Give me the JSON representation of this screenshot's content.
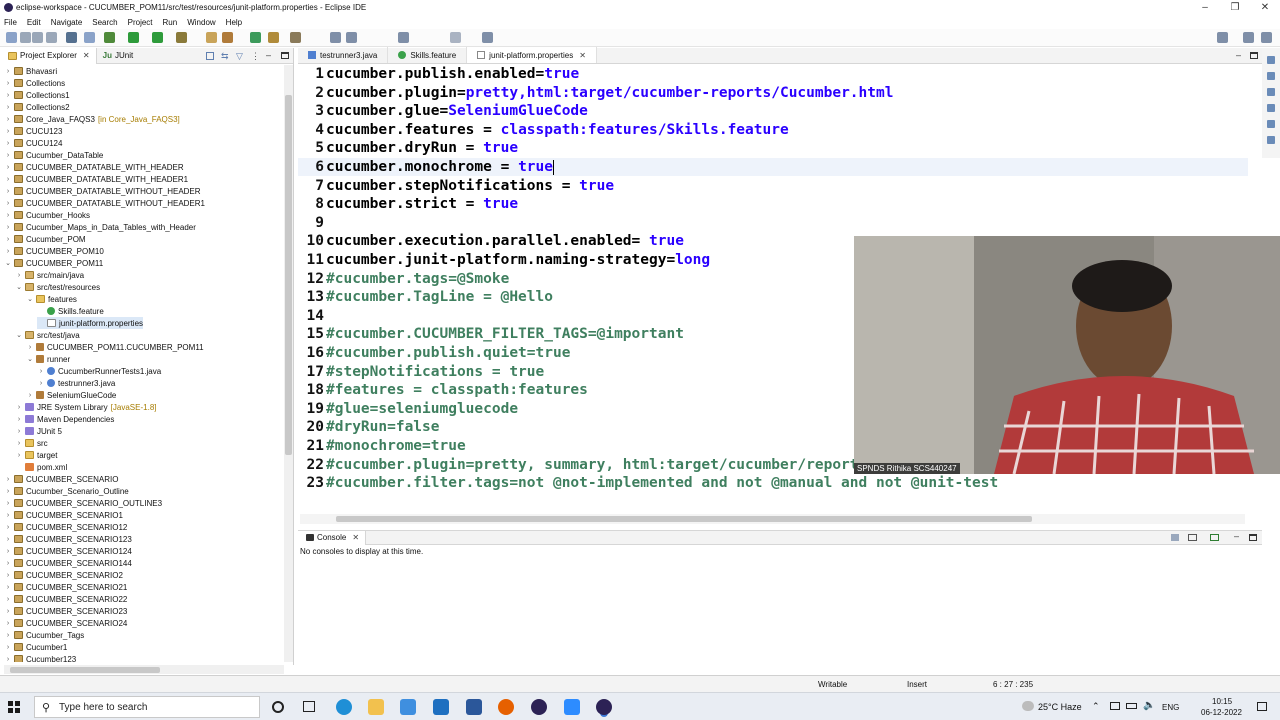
{
  "window": {
    "title": "eclipse-workspace - CUCUMBER_POM11/src/test/resources/junit-platform.properties - Eclipse IDE"
  },
  "menu": [
    "File",
    "Edit",
    "Navigate",
    "Search",
    "Project",
    "Run",
    "Window",
    "Help"
  ],
  "left_panel": {
    "tabs": [
      "Project Explorer",
      "JUnit"
    ],
    "tree": [
      {
        "label": "Bhavasri",
        "depth": 0,
        "icon": "project-icon",
        "tw": "›"
      },
      {
        "label": "Collections",
        "depth": 0,
        "icon": "project-icon",
        "tw": "›"
      },
      {
        "label": "Collections1",
        "depth": 0,
        "icon": "project-icon",
        "tw": "›"
      },
      {
        "label": "Collections2",
        "depth": 0,
        "icon": "project-icon",
        "tw": "›"
      },
      {
        "label": "Core_Java_FAQS3",
        "annotation": "[in Core_Java_FAQS3]",
        "depth": 0,
        "icon": "project-icon",
        "tw": "›"
      },
      {
        "label": "CUCU123",
        "depth": 0,
        "icon": "project-icon",
        "tw": "›"
      },
      {
        "label": "CUCU124",
        "depth": 0,
        "icon": "project-icon",
        "tw": "›"
      },
      {
        "label": "Cucumber_DataTable",
        "depth": 0,
        "icon": "project-icon",
        "tw": "›"
      },
      {
        "label": "CUCUMBER_DATATABLE_WITH_HEADER",
        "depth": 0,
        "icon": "project-icon",
        "tw": "›"
      },
      {
        "label": "CUCUMBER_DATATABLE_WITH_HEADER1",
        "depth": 0,
        "icon": "project-icon",
        "tw": "›"
      },
      {
        "label": "CUCUMBER_DATATABLE_WITHOUT_HEADER",
        "depth": 0,
        "icon": "project-icon",
        "tw": "›"
      },
      {
        "label": "CUCUMBER_DATATABLE_WITHOUT_HEADER1",
        "depth": 0,
        "icon": "project-icon",
        "tw": "›"
      },
      {
        "label": "Cucumber_Hooks",
        "depth": 0,
        "icon": "project-icon",
        "tw": "›"
      },
      {
        "label": "Cucumber_Maps_in_Data_Tables_with_Header",
        "depth": 0,
        "icon": "project-icon",
        "tw": "›"
      },
      {
        "label": "Cucumber_POM",
        "depth": 0,
        "icon": "project-icon",
        "tw": "›"
      },
      {
        "label": "CUCUMBER_POM10",
        "depth": 0,
        "icon": "project-icon",
        "tw": "›"
      },
      {
        "label": "CUCUMBER_POM11",
        "depth": 0,
        "icon": "project-icon",
        "tw": "⌄"
      },
      {
        "label": "src/main/java",
        "depth": 1,
        "icon": "source-folder-icon",
        "tw": "›"
      },
      {
        "label": "src/test/resources",
        "depth": 1,
        "icon": "source-folder-icon",
        "tw": "⌄"
      },
      {
        "label": "features",
        "depth": 2,
        "icon": "folder-icon",
        "tw": "⌄"
      },
      {
        "label": "Skills.feature",
        "depth": 3,
        "icon": "feature-file-icon",
        "tw": ""
      },
      {
        "label": "junit-platform.properties",
        "depth": 3,
        "icon": "properties-file-icon",
        "tw": "",
        "selected": true
      },
      {
        "label": "src/test/java",
        "depth": 1,
        "icon": "source-folder-icon",
        "tw": "⌄"
      },
      {
        "label": "CUCUMBER_POM11.CUCUMBER_POM11",
        "depth": 2,
        "icon": "package-icon",
        "tw": "›"
      },
      {
        "label": "runner",
        "depth": 2,
        "icon": "package-icon",
        "tw": "⌄"
      },
      {
        "label": "CucumberRunnerTests1.java",
        "depth": 3,
        "icon": "java-file-icon",
        "tw": "›"
      },
      {
        "label": "testrunner3.java",
        "depth": 3,
        "icon": "java-file-icon",
        "tw": "›"
      },
      {
        "label": "SeleniumGlueCode",
        "depth": 2,
        "icon": "package-icon",
        "tw": "›"
      },
      {
        "label": "JRE System Library",
        "annotation": "[JavaSE-1.8]",
        "depth": 1,
        "icon": "library-icon",
        "tw": "›"
      },
      {
        "label": "Maven Dependencies",
        "depth": 1,
        "icon": "library-icon",
        "tw": "›"
      },
      {
        "label": "JUnit 5",
        "depth": 1,
        "icon": "library-icon",
        "tw": "›"
      },
      {
        "label": "src",
        "depth": 1,
        "icon": "folder-icon",
        "tw": "›"
      },
      {
        "label": "target",
        "depth": 1,
        "icon": "folder-icon",
        "tw": "›"
      },
      {
        "label": "pom.xml",
        "depth": 1,
        "icon": "xml-file-icon",
        "tw": ""
      },
      {
        "label": "CUCUMBER_SCENARIO",
        "depth": 0,
        "icon": "project-icon",
        "tw": "›"
      },
      {
        "label": "Cucumber_Scenario_Outline",
        "depth": 0,
        "icon": "project-icon",
        "tw": "›"
      },
      {
        "label": "CUCUMBER_SCENARIO_OUTLINE3",
        "depth": 0,
        "icon": "project-icon",
        "tw": "›"
      },
      {
        "label": "CUCUMBER_SCENARIO1",
        "depth": 0,
        "icon": "project-icon",
        "tw": "›"
      },
      {
        "label": "CUCUMBER_SCENARIO12",
        "depth": 0,
        "icon": "project-icon",
        "tw": "›"
      },
      {
        "label": "CUCUMBER_SCENARIO123",
        "depth": 0,
        "icon": "project-icon",
        "tw": "›"
      },
      {
        "label": "CUCUMBER_SCENARIO124",
        "depth": 0,
        "icon": "project-icon",
        "tw": "›"
      },
      {
        "label": "CUCUMBER_SCENARIO144",
        "depth": 0,
        "icon": "project-icon",
        "tw": "›"
      },
      {
        "label": "CUCUMBER_SCENARIO2",
        "depth": 0,
        "icon": "project-icon",
        "tw": "›"
      },
      {
        "label": "CUCUMBER_SCENARIO21",
        "depth": 0,
        "icon": "project-icon",
        "tw": "›"
      },
      {
        "label": "CUCUMBER_SCENARIO22",
        "depth": 0,
        "icon": "project-icon",
        "tw": "›"
      },
      {
        "label": "CUCUMBER_SCENARIO23",
        "depth": 0,
        "icon": "project-icon",
        "tw": "›"
      },
      {
        "label": "CUCUMBER_SCENARIO24",
        "depth": 0,
        "icon": "project-icon",
        "tw": "›"
      },
      {
        "label": "Cucumber_Tags",
        "depth": 0,
        "icon": "project-icon",
        "tw": "›"
      },
      {
        "label": "Cucumber1",
        "depth": 0,
        "icon": "project-icon",
        "tw": "›"
      },
      {
        "label": "Cucumber123",
        "depth": 0,
        "icon": "project-icon",
        "tw": "›"
      }
    ]
  },
  "editor": {
    "tabs": [
      {
        "label": "testrunner3.java",
        "icon": "java-file-icon",
        "active": false
      },
      {
        "label": "Skills.feature",
        "icon": "feature-file-icon",
        "active": false
      },
      {
        "label": "junit-platform.properties",
        "icon": "properties-file-icon",
        "active": true
      }
    ],
    "lines": [
      {
        "n": "1",
        "key": "cucumber.publish.enabled=",
        "val": "true"
      },
      {
        "n": "2",
        "key": "cucumber.plugin=",
        "val": "pretty,html:target/cucumber-reports/Cucumber.html"
      },
      {
        "n": "3",
        "key": "cucumber.glue=",
        "val": "SeleniumGlueCode"
      },
      {
        "n": "4",
        "key": "cucumber.features = ",
        "val": "classpath:features/Skills.feature"
      },
      {
        "n": "5",
        "key": "cucumber.dryRun = ",
        "val": "true"
      },
      {
        "n": "6",
        "key": "cucumber.monochrome = ",
        "val": "true",
        "current": true
      },
      {
        "n": "7",
        "key": "cucumber.stepNotifications = ",
        "val": "true"
      },
      {
        "n": "8",
        "key": "cucumber.strict = ",
        "val": "true"
      },
      {
        "n": "9",
        "key": "",
        "val": ""
      },
      {
        "n": "10",
        "key": "cucumber.execution.parallel.enabled= ",
        "val": "true"
      },
      {
        "n": "11",
        "key": "cucumber.junit-platform.naming-strategy=",
        "val": "long"
      },
      {
        "n": "12",
        "comment": "#cucumber.tags=@Smoke"
      },
      {
        "n": "13",
        "comment": "#cucumber.TagLine = @Hello"
      },
      {
        "n": "14",
        "key": "",
        "val": ""
      },
      {
        "n": "15",
        "comment": "#cucumber.CUCUMBER_FILTER_TAGS=@important"
      },
      {
        "n": "16",
        "comment": "#cucumber.publish.quiet=true"
      },
      {
        "n": "17",
        "comment": "#stepNotifications = true"
      },
      {
        "n": "18",
        "comment": "#features = classpath:features"
      },
      {
        "n": "19",
        "comment": "#glue=seleniumgluecode"
      },
      {
        "n": "20",
        "comment": "#dryRun=false"
      },
      {
        "n": "21",
        "comment": "#monochrome=true"
      },
      {
        "n": "22",
        "comment": "#cucumber.plugin=pretty, summary, html:target/cucumber/report"
      },
      {
        "n": "23",
        "comment": "#cucumber.filter.tags=not @not-implemented and not @manual and not @unit-test"
      }
    ]
  },
  "console": {
    "tab": "Console",
    "message": "No consoles to display at this time."
  },
  "status": {
    "writable": "Writable",
    "insert": "Insert",
    "position": "6 : 27 : 235"
  },
  "video_overlay": {
    "name": "SPNDS Rithika SCS440247"
  },
  "taskbar": {
    "search_placeholder": "Type here to search",
    "weather": "25°C  Haze",
    "lang": "ENG",
    "time": "10:15",
    "date": "06-12-2022"
  },
  "colors": {
    "keyword": "#000000",
    "value": "#2a00ff",
    "comment": "#3f7f5f",
    "selection": "#dbe8f7"
  }
}
